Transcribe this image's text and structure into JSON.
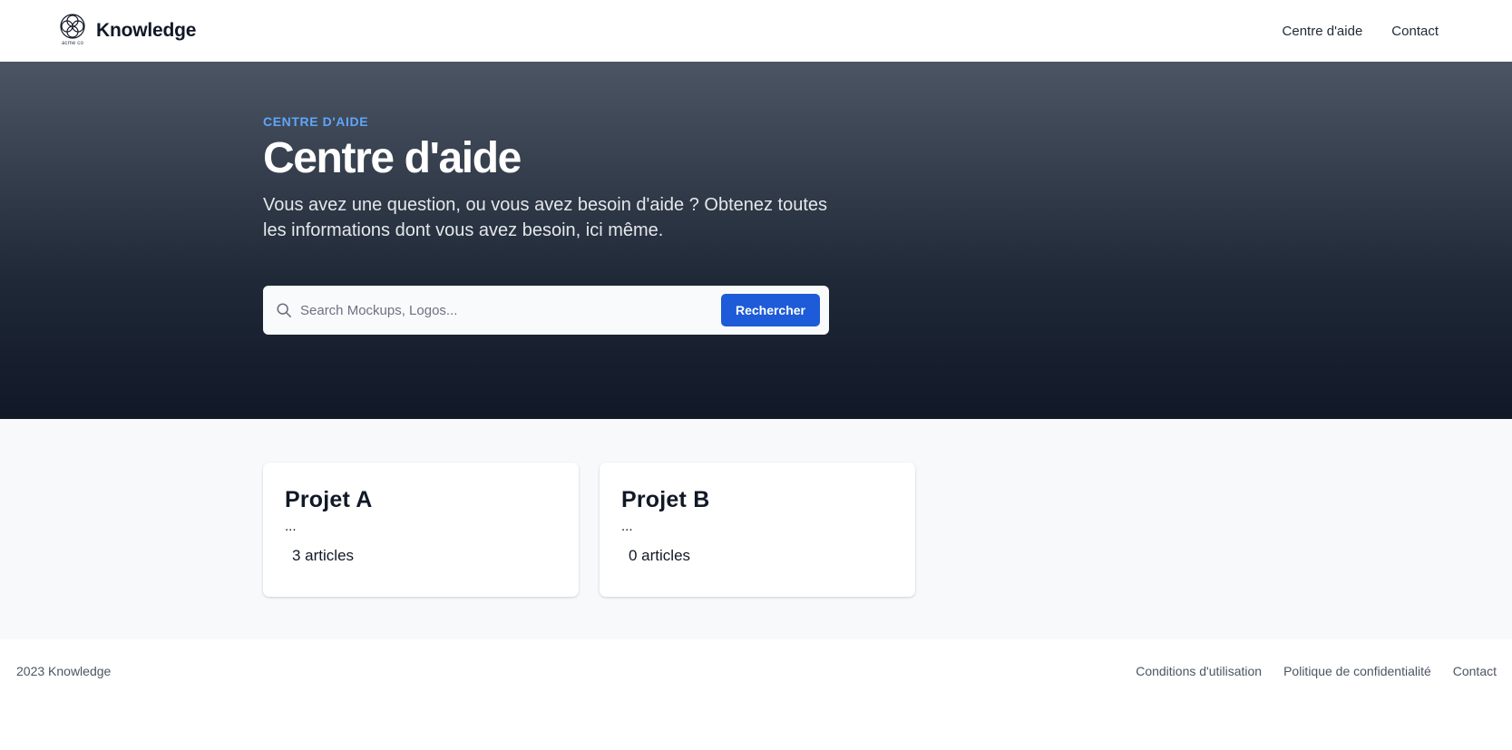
{
  "header": {
    "logo_text": "acme co",
    "brand_name": "Knowledge",
    "nav": [
      {
        "label": "Centre d'aide"
      },
      {
        "label": "Contact"
      }
    ]
  },
  "hero": {
    "eyebrow": "CENTRE D'AIDE",
    "title": "Centre d'aide",
    "subtitle": "Vous avez une question, ou vous avez besoin d'aide ? Obtenez toutes les informations dont vous avez besoin, ici même.",
    "search": {
      "placeholder": "Search Mockups, Logos...",
      "value": "",
      "button_label": "Rechercher",
      "icon": "search-icon"
    }
  },
  "projects": [
    {
      "title": "Projet A",
      "description": "...",
      "count": "3 articles"
    },
    {
      "title": "Projet B",
      "description": "...",
      "count": "0 articles"
    }
  ],
  "footer": {
    "copyright": "2023 Knowledge",
    "links": [
      {
        "label": "Conditions d'utilisation"
      },
      {
        "label": "Politique de confidentialité"
      },
      {
        "label": "Contact"
      }
    ]
  },
  "colors": {
    "accent": "#1d5bd8",
    "eyebrow": "#60a5fa",
    "hero_top": "#4b5563",
    "hero_bottom": "#111827"
  }
}
